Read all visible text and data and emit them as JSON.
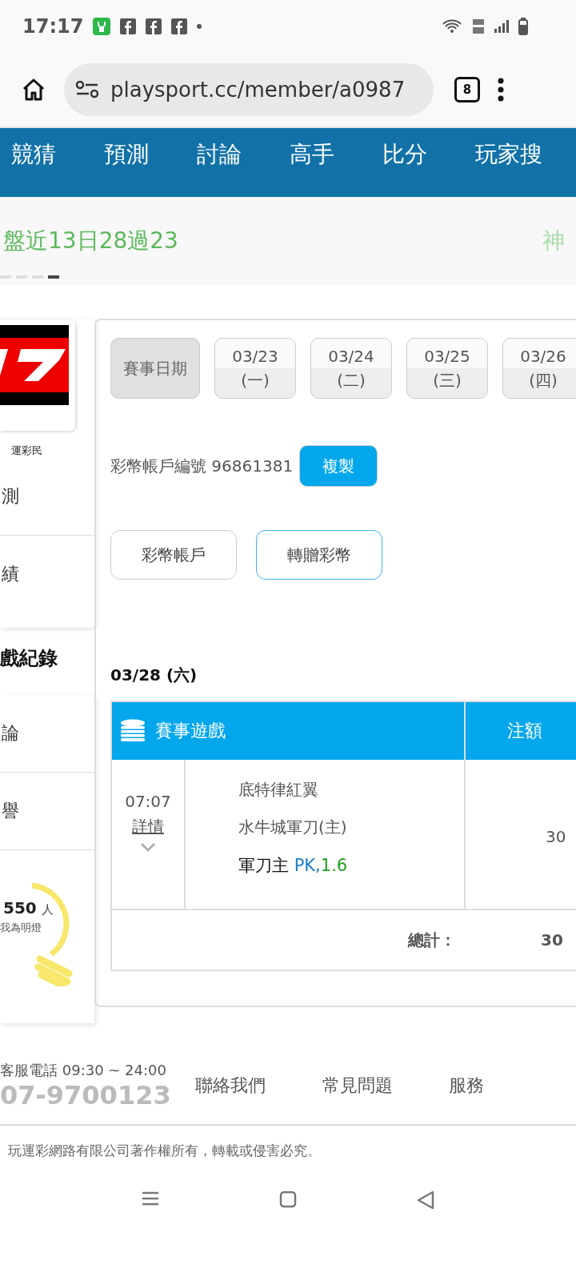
{
  "status_bar": {
    "time": "17:17"
  },
  "browser": {
    "url": "playsport.cc/member/a0987",
    "tab_count": "8"
  },
  "nav": [
    {
      "label": "競猜"
    },
    {
      "label": "預測"
    },
    {
      "label": "討論"
    },
    {
      "label": "高手"
    },
    {
      "label": "比分"
    },
    {
      "label": "玩家搜"
    }
  ],
  "ticker": {
    "text": "盤近13日28過23",
    "text_2": "神",
    "dots": [
      {
        "selected": false
      },
      {
        "selected": false
      },
      {
        "selected": false
      },
      {
        "selected": true
      }
    ]
  },
  "sidebar": {
    "name": "運彩民",
    "items": [
      {
        "label": "測"
      },
      {
        "label": "績"
      }
    ],
    "section_title": "戲紀錄",
    "items_2": [
      {
        "label": "論"
      },
      {
        "label": "譽"
      }
    ],
    "lamp": {
      "count": "550",
      "unit": "人",
      "caption": "我為明燈"
    }
  },
  "panel": {
    "date_chips": [
      {
        "label": "賽事日期",
        "selected": true
      },
      {
        "label": "03/23",
        "weekday": "(一)",
        "selected": false
      },
      {
        "label": "03/24",
        "weekday": "(二)",
        "selected": false
      },
      {
        "label": "03/25",
        "weekday": "(三)",
        "selected": false
      },
      {
        "label": "03/26",
        "weekday": "(四)",
        "selected": false
      }
    ],
    "account": {
      "text": "彩幣帳戶編號 96861381",
      "copy_button": "複製"
    },
    "buttons": [
      {
        "label": "彩幣帳戶",
        "selected": false
      },
      {
        "label": "轉贈彩幣",
        "selected": true
      }
    ],
    "date_heading": "03/28 (六)",
    "table": {
      "columns": [
        "賽事遊戲",
        "注額"
      ],
      "rows": [
        {
          "time": "07:07",
          "details": "詳情",
          "away": "底特律紅翼",
          "home": "水牛城軍刀(主)",
          "pick": "軍刀主",
          "line": "PK,",
          "odds": "1.6",
          "stake": "30"
        }
      ],
      "total_label": "總計：",
      "total": "30"
    }
  },
  "footer": {
    "hotline_label": "客服電話 09:30 ~ 24:00",
    "phone": "07-9700123",
    "links": [
      "聯絡我們",
      "常見問題",
      "服務"
    ],
    "copyright": "玩運彩網路有限公司著作權所有，轉載或侵害必究。"
  }
}
